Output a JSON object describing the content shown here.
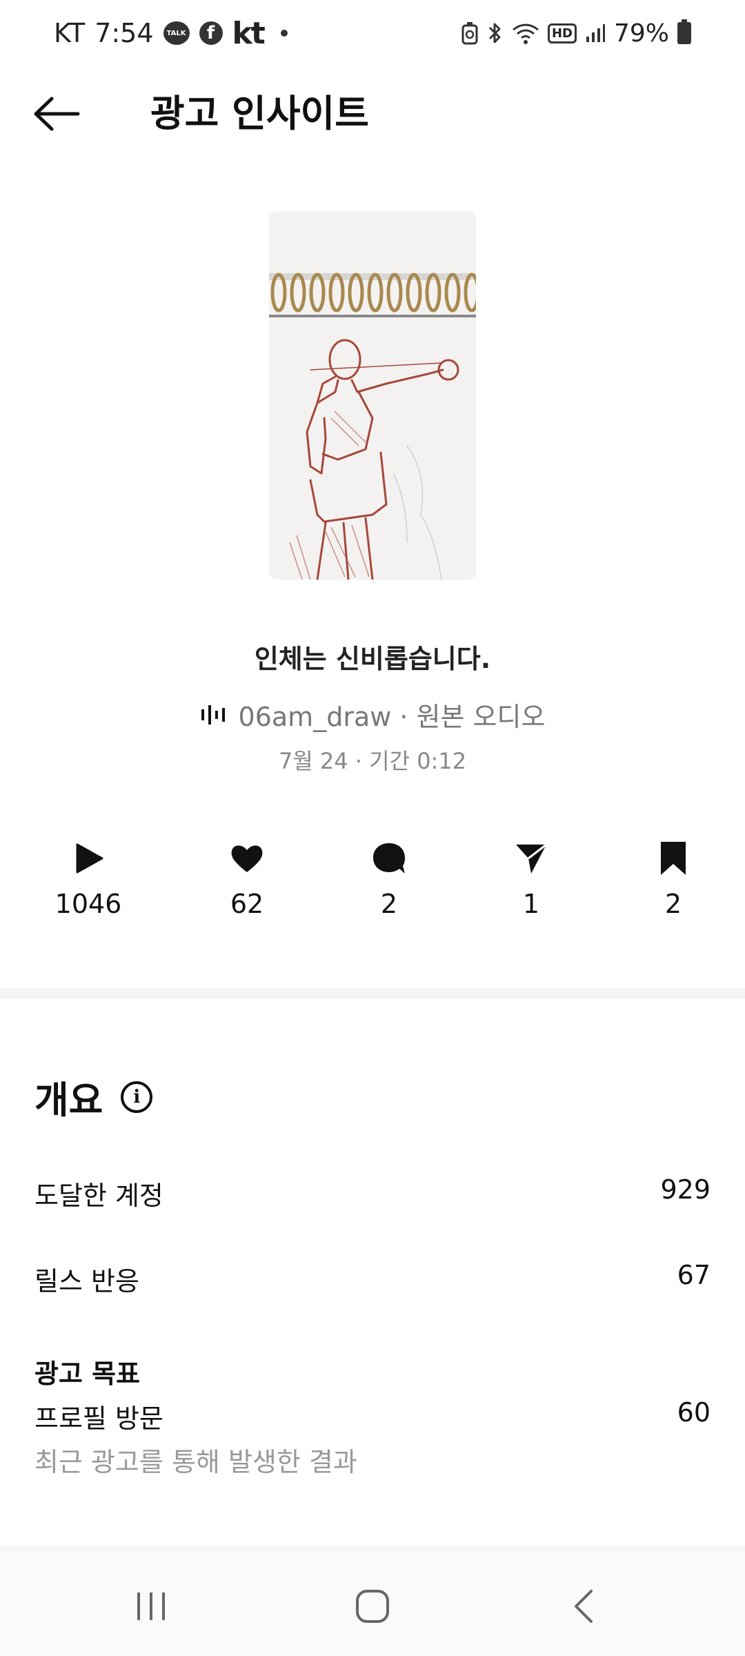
{
  "status_bar": {
    "carrier": "KT",
    "time": "7:54",
    "talk_icon_label": "TALK",
    "fb_icon_label": "f",
    "kt_logo": "kt",
    "battery": "79%",
    "hd_label": "HD"
  },
  "header": {
    "title": "광고 인사이트"
  },
  "reel": {
    "caption": "인체는 신비롭습니다.",
    "audio": "06am_draw · 원본 오디오",
    "meta": "7월 24 · 기간 0:12"
  },
  "stats": {
    "plays": "1046",
    "likes": "62",
    "comments": "2",
    "shares": "1",
    "saves": "2"
  },
  "overview": {
    "title": "개요",
    "accounts_reached_label": "도달한 계정",
    "accounts_reached_value": "929",
    "reel_interactions_label": "릴스 반응",
    "reel_interactions_value": "67",
    "ad_goal_title": "광고 목표",
    "profile_visits_label": "프로필 방문",
    "profile_visits_value": "60",
    "ad_goal_sub": "최근 광고를 통해 발생한 결과"
  }
}
